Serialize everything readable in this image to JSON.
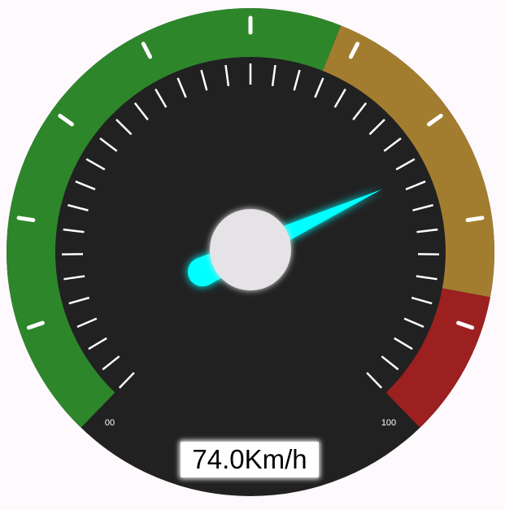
{
  "gauge": {
    "min_label": "00",
    "max_label": "100",
    "min_value": 0,
    "max_value": 100,
    "value": 74.0,
    "readout": "74.0Km/h",
    "zones": [
      {
        "name": "normal",
        "from": 0,
        "to": 58,
        "color": "#2e862a"
      },
      {
        "name": "warning",
        "from": 58,
        "to": 87,
        "color": "#a37d2f"
      },
      {
        "name": "danger",
        "from": 87,
        "to": 100,
        "color": "#9c2020"
      }
    ],
    "colors": {
      "face": "#212121",
      "needle": "#00ffff",
      "hub": "#e6e3e6",
      "tick": "#ffffff"
    }
  }
}
